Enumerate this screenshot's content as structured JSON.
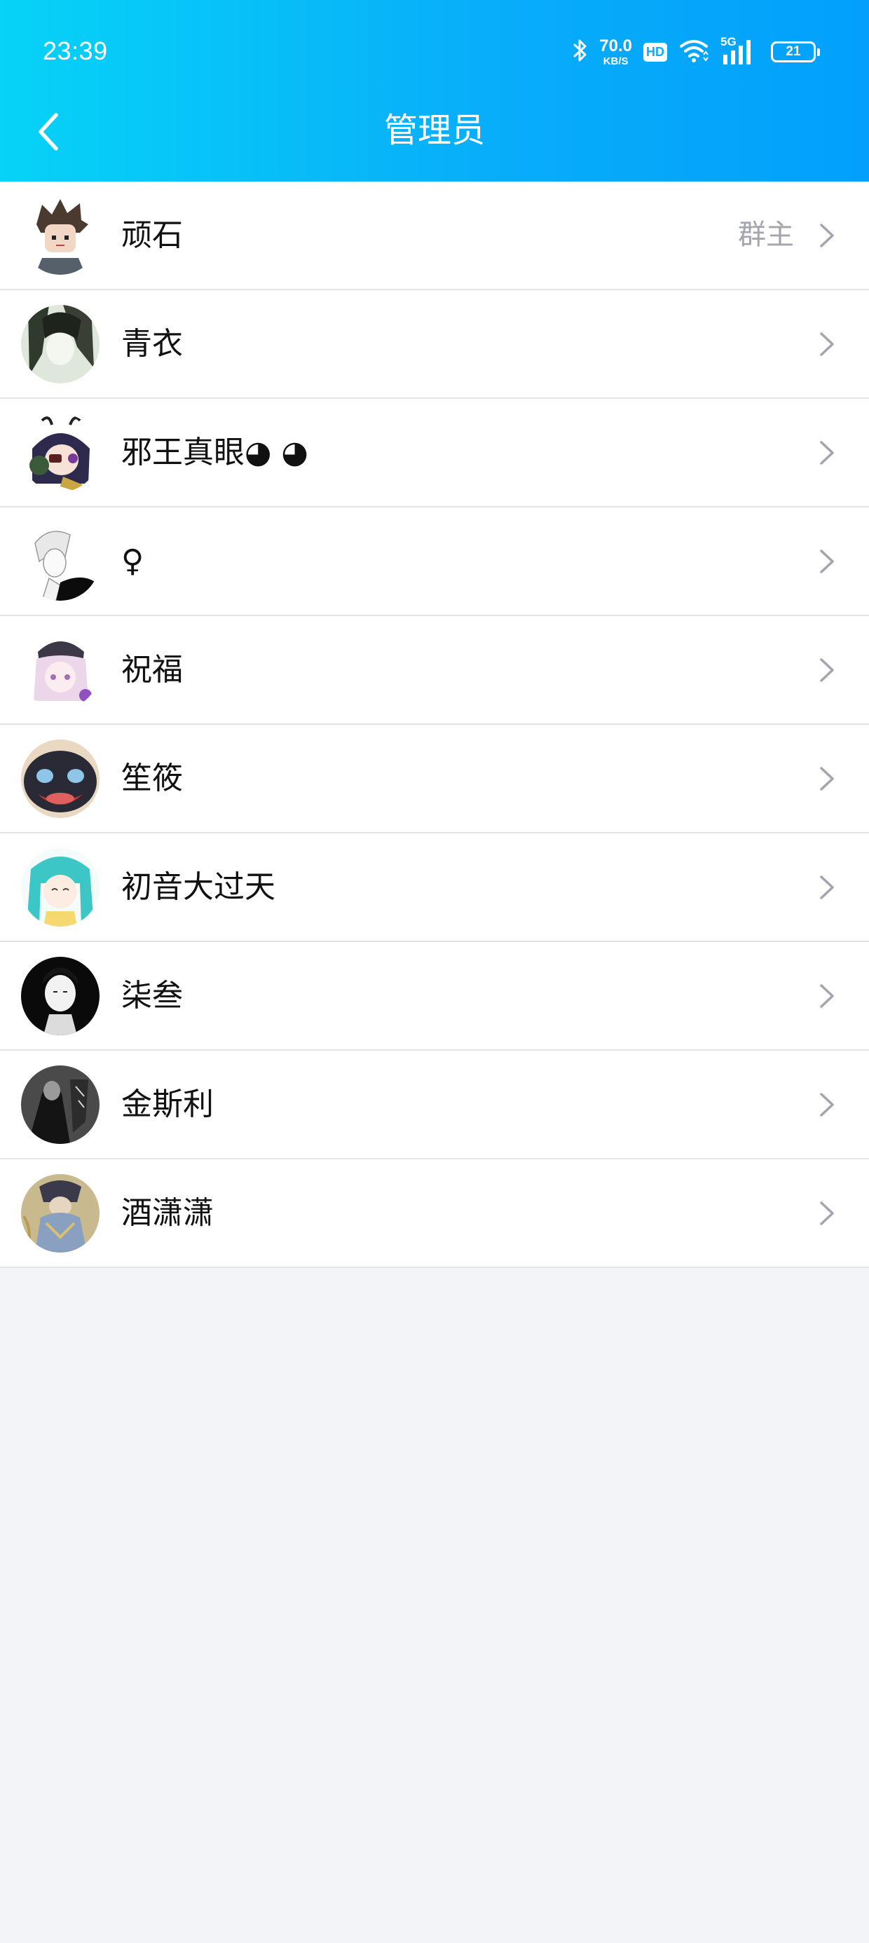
{
  "status_bar": {
    "time": "23:39",
    "net_speed": "70.0",
    "net_speed_unit": "KB/S",
    "hd_label": "HD",
    "network_label": "5G",
    "battery_level": "21"
  },
  "header": {
    "title": "管理员",
    "back_icon": "chevron-left-icon"
  },
  "members": [
    {
      "name": "顽石",
      "badge": "群主",
      "avatar_icon": "avatar-brown-hair-boy"
    },
    {
      "name": "青衣",
      "badge": "",
      "avatar_icon": "avatar-dark-sketch"
    },
    {
      "name": "邪王真眼◕ ◕",
      "badge": "",
      "avatar_icon": "avatar-anime-eyepatch"
    },
    {
      "name": "♀",
      "badge": "",
      "avatar_icon": "avatar-white-hair-sketch"
    },
    {
      "name": "祝福",
      "badge": "",
      "avatar_icon": "avatar-pink-hair-girl"
    },
    {
      "name": "笙筱",
      "badge": "",
      "avatar_icon": "avatar-dark-creature"
    },
    {
      "name": "初音大过天",
      "badge": "",
      "avatar_icon": "avatar-teal-hair-girl"
    },
    {
      "name": "柒叁",
      "badge": "",
      "avatar_icon": "avatar-monochrome-girl"
    },
    {
      "name": "金斯利",
      "badge": "",
      "avatar_icon": "avatar-gray-illustration"
    },
    {
      "name": "酒潇潇",
      "badge": "",
      "avatar_icon": "avatar-armored-figure"
    }
  ],
  "colors": {
    "header_gradient_start": "#06d3f7",
    "header_gradient_end": "#02a0fc",
    "background": "#f3f4f8",
    "divider": "#e3e3e8",
    "chevron": "#a4a4ae"
  }
}
